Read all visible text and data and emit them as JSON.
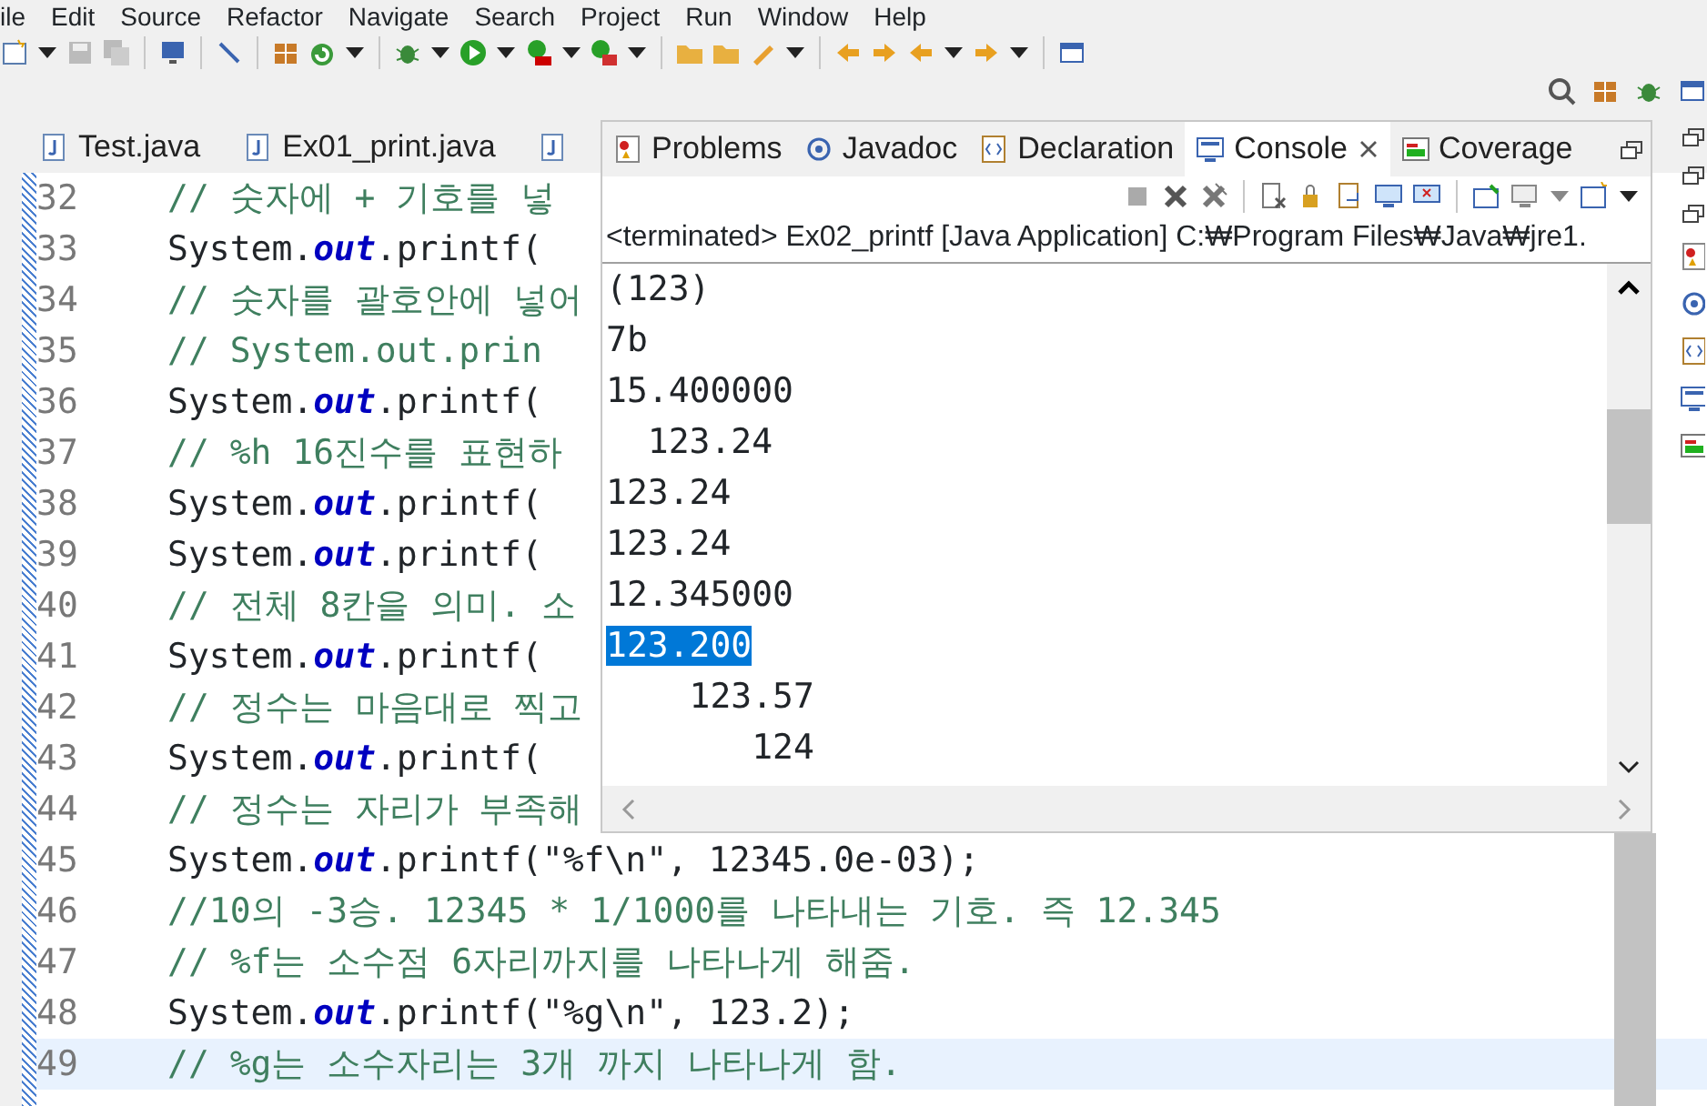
{
  "menu": [
    "ile",
    "Edit",
    "Source",
    "Refactor",
    "Navigate",
    "Search",
    "Project",
    "Run",
    "Window",
    "Help"
  ],
  "editor": {
    "tabs": [
      {
        "label": "Test.java"
      },
      {
        "label": "Ex01_print.java"
      }
    ],
    "lines": [
      {
        "number": "32",
        "kind": "comment",
        "text": "// 숫자에 + 기호를 넣",
        "current": false
      },
      {
        "number": "33",
        "kind": "code",
        "text": "System.**out**.printf(",
        "current": false
      },
      {
        "number": "34",
        "kind": "comment",
        "text": "// 숫자를 괄호안에 넣어",
        "current": false
      },
      {
        "number": "35",
        "kind": "comment",
        "text": "// System.out.prin",
        "current": false
      },
      {
        "number": "36",
        "kind": "code",
        "text": "System.**out**.printf(",
        "current": false
      },
      {
        "number": "37",
        "kind": "comment",
        "text": "// %h 16진수를 표현하",
        "current": false
      },
      {
        "number": "38",
        "kind": "code",
        "text": "System.**out**.printf(",
        "current": false
      },
      {
        "number": "39",
        "kind": "code",
        "text": "System.**out**.printf(",
        "current": false
      },
      {
        "number": "40",
        "kind": "comment",
        "text": "// 전체 8칸을 의미. 소",
        "current": false
      },
      {
        "number": "41",
        "kind": "code",
        "text": "System.**out**.printf(",
        "current": false
      },
      {
        "number": "42",
        "kind": "comment",
        "text": "// 정수는 마음대로 찍고",
        "current": false
      },
      {
        "number": "43",
        "kind": "code",
        "text": "System.**out**.printf(",
        "current": false
      },
      {
        "number": "44",
        "kind": "comment",
        "text": "// 정수는 자리가 부족해",
        "current": false
      },
      {
        "number": "45",
        "kind": "code",
        "text": "System.**out**.printf(\"%f\\n\", 12345.0e-03);",
        "current": false
      },
      {
        "number": "46",
        "kind": "comment",
        "text": "//10의 -3승. 12345 * 1/1000를 나타내는 기호. 즉 12.345",
        "current": false
      },
      {
        "number": "47",
        "kind": "comment",
        "text": "// %f는 소수점 6자리까지를 나타나게 해줌.",
        "current": false
      },
      {
        "number": "48",
        "kind": "code",
        "text": "System.**out**.printf(\"%g\\n\", 123.2);",
        "current": false
      },
      {
        "number": "49",
        "kind": "comment",
        "text": "// %g는 소수자리는 3개 까지 나타나게 함.",
        "current": true
      }
    ]
  },
  "console": {
    "tabs": [
      {
        "label": "Problems",
        "selected": false
      },
      {
        "label": "Javadoc",
        "selected": false
      },
      {
        "label": "Declaration",
        "selected": false
      },
      {
        "label": "Console",
        "selected": true
      },
      {
        "label": "Coverage",
        "selected": false
      }
    ],
    "title": "<terminated> Ex02_printf [Java Application] C:₩Program Files₩Java₩jre1.",
    "output": [
      {
        "text": "(123)",
        "selected": false
      },
      {
        "text": "7b",
        "selected": false
      },
      {
        "text": "15.400000",
        "selected": false
      },
      {
        "text": "  123.24",
        "selected": false
      },
      {
        "text": "123.24",
        "selected": false
      },
      {
        "text": "123.24",
        "selected": false
      },
      {
        "text": "12.345000",
        "selected": false
      },
      {
        "text": "123.200",
        "selected": true
      },
      {
        "text": "    123.57",
        "selected": false
      },
      {
        "text": "       124",
        "selected": false
      }
    ]
  }
}
